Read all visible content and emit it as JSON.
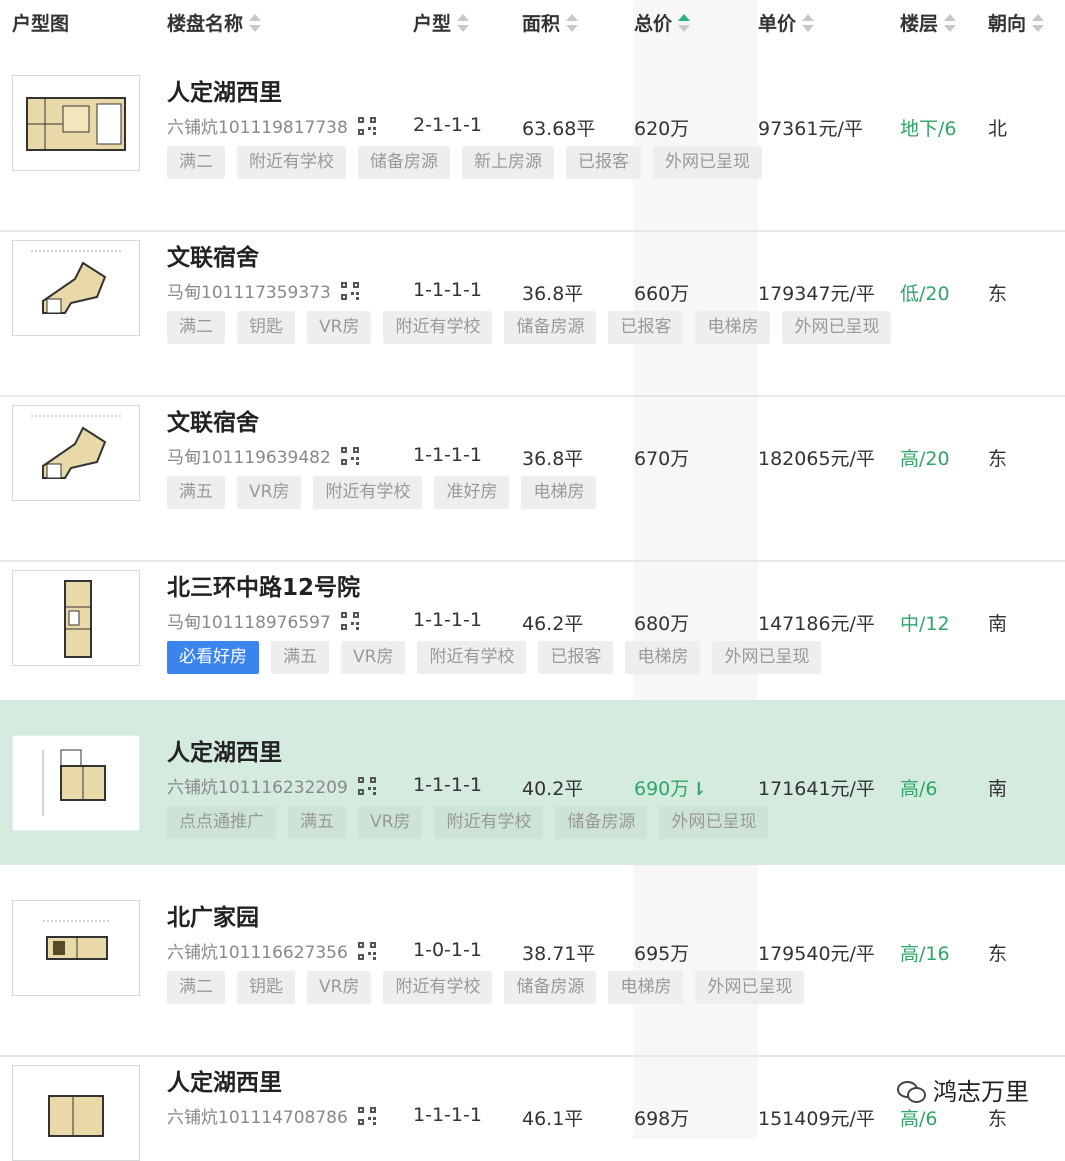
{
  "header": {
    "thumb": "户型图",
    "name": "楼盘名称",
    "layout": "户型",
    "area": "面积",
    "total": "总价",
    "unit": "单价",
    "floor": "楼层",
    "direction": "朝向"
  },
  "colors": {
    "accent_green": "#2fa567",
    "highlight_row": "#d5ebdf",
    "tag_blue": "#3a84f0",
    "tag_red": "#f23f3f"
  },
  "rows": [
    {
      "name": "人定湖西里",
      "code": "六铺炕101119817738",
      "layout": "2-1-1-1",
      "area": "63.68平",
      "total": "620万",
      "unit": "97361元/平",
      "floor": "地下/6",
      "direction": "北",
      "tags": [
        "满二",
        "附近有学校",
        "储备房源",
        "新上房源",
        "已报客",
        "外网已呈现"
      ]
    },
    {
      "name": "文联宿舍",
      "code": "马甸101117359373",
      "layout": "1-1-1-1",
      "area": "36.8平",
      "total": "660万",
      "unit": "179347元/平",
      "floor": "低/20",
      "direction": "东",
      "tags": [
        "满二",
        "钥匙",
        "VR房",
        "附近有学校",
        "储备房源",
        "已报客",
        "电梯房",
        "外网已呈现"
      ]
    },
    {
      "name": "文联宿舍",
      "code": "马甸101119639482",
      "layout": "1-1-1-1",
      "area": "36.8平",
      "total": "670万",
      "unit": "182065元/平",
      "floor": "高/20",
      "direction": "东",
      "tags": [
        "满五",
        "VR房",
        "附近有学校",
        "准好房",
        "电梯房"
      ]
    },
    {
      "name": "北三环中路12号院",
      "code": "马甸101118976597",
      "layout": "1-1-1-1",
      "area": "46.2平",
      "total": "680万",
      "unit": "147186元/平",
      "floor": "中/12",
      "direction": "南",
      "special_tag": "必看好房",
      "tags": [
        "满五",
        "VR房",
        "附近有学校",
        "已报客",
        "电梯房",
        "外网已呈现"
      ]
    },
    {
      "name": "人定湖西里",
      "code": "六铺炕101116232209",
      "layout": "1-1-1-1",
      "area": "40.2平",
      "total": "690万",
      "unit": "171641元/平",
      "floor": "高/6",
      "direction": "南",
      "special_tag": "点点通推广",
      "tags": [
        "满五",
        "VR房",
        "附近有学校",
        "储备房源",
        "外网已呈现"
      ]
    },
    {
      "name": "北广家园",
      "code": "六铺炕101116627356",
      "layout": "1-0-1-1",
      "area": "38.71平",
      "total": "695万",
      "unit": "179540元/平",
      "floor": "高/16",
      "direction": "东",
      "tags": [
        "满二",
        "钥匙",
        "VR房",
        "附近有学校",
        "储备房源",
        "电梯房",
        "外网已呈现"
      ]
    },
    {
      "name": "人定湖西里",
      "code": "六铺炕101114708786",
      "layout": "1-1-1-1",
      "area": "46.1平",
      "total": "698万",
      "unit": "151409元/平",
      "floor": "高/6",
      "direction": "东",
      "tags": []
    }
  ],
  "watermark": "鸿志万里"
}
